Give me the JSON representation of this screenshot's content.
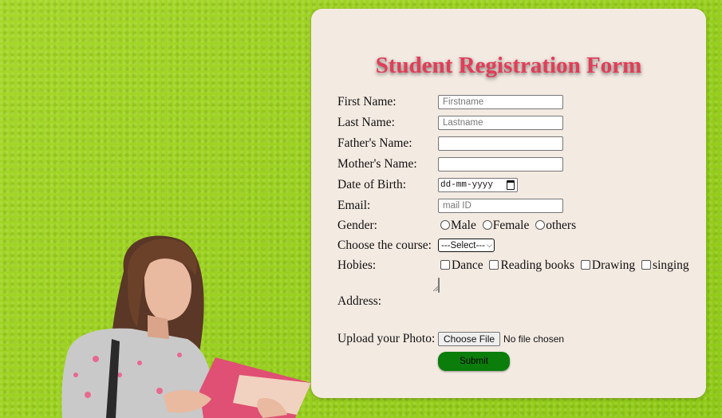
{
  "form": {
    "title": "Student Registration Form",
    "first_name": {
      "label": "First Name:",
      "placeholder": "Firstname"
    },
    "last_name": {
      "label": "Last Name:",
      "placeholder": "Lastname"
    },
    "father_name": {
      "label": "Father's Name:"
    },
    "mother_name": {
      "label": "Mother's Name:"
    },
    "dob": {
      "label": "Date of Birth:",
      "value": "dd-mm-yyyy"
    },
    "email": {
      "label": "Email:",
      "placeholder": "mail ID"
    },
    "gender": {
      "label": "Gender:",
      "options": [
        "Male",
        "Female",
        "others"
      ]
    },
    "course": {
      "label": "Choose the course:",
      "selected": "---Select---"
    },
    "hobbies": {
      "label": "Hobies:",
      "options": [
        "Dance",
        "Reading books",
        "Drawing",
        "singing"
      ]
    },
    "address": {
      "label": "Address:"
    },
    "photo": {
      "label": "Upload your Photo:",
      "button": "Choose File",
      "status": "No file chosen"
    },
    "submit": "Submit"
  },
  "colors": {
    "background": "#9bd11f",
    "card": "#f3eae2",
    "title": "#e23d57",
    "submit": "#0b7d0b"
  }
}
